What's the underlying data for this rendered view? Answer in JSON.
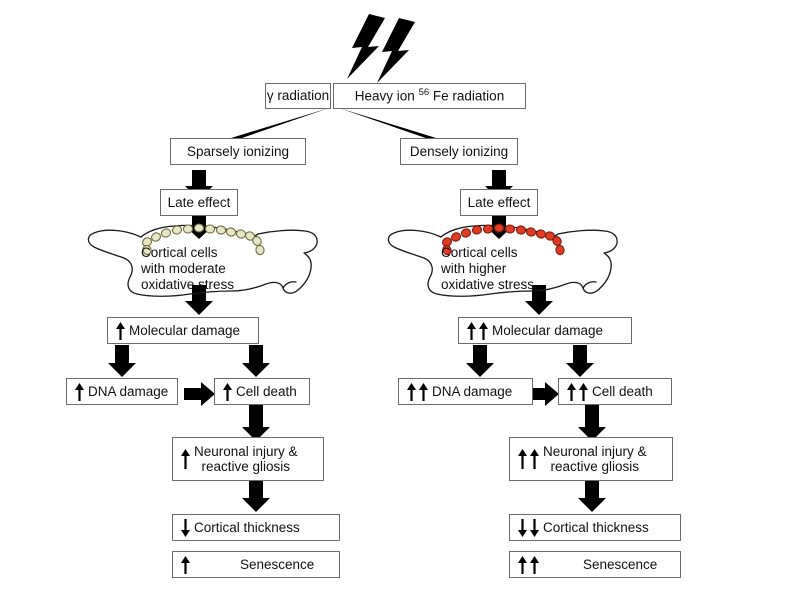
{
  "figure": {
    "title": "Radiation-induced cortical damage pathway schematic",
    "type": "flow-diagram",
    "background": "#ffffff",
    "colors": {
      "box_border": "#6b6b6b",
      "arrow_fill": "#000000",
      "bolt_fill": "#000000",
      "left_cell_fill": "#e8e6c8",
      "left_cell_stroke": "#6f6f3a",
      "right_cell_fill": "#e03c24",
      "right_cell_stroke": "#7d1b0c",
      "animal_outline": "#1a1a1a",
      "text": "#111111"
    }
  },
  "source": {
    "bolt_count": 2,
    "bolt_name": "radiation-bolts"
  },
  "top_boxes": [
    {
      "id": "gamma",
      "label": "γ radiation"
    },
    {
      "id": "heavy_ion",
      "label_pre": "Heavy ion ",
      "label_sup": "56",
      "label_post": " Fe radiation",
      "label_full": "Heavy ion 56 Fe radiation"
    }
  ],
  "branches": {
    "left": {
      "name": "sparsely-ionizing-branch",
      "ionizing": "Sparsely ionizing",
      "late_effect": "Late effect",
      "animal_caption": "Cortical cells\nwith moderate\noxidative stress",
      "cell_color": "#e8e6c8",
      "cell_count": 14,
      "steps": [
        {
          "id": "molecular_damage",
          "label": "Molecular damage",
          "arrows": "up",
          "arrow_count": 1
        },
        {
          "id": "dna_damage",
          "label": "DNA damage",
          "arrows": "up",
          "arrow_count": 1
        },
        {
          "id": "cell_death",
          "label": "Cell death",
          "arrows": "up",
          "arrow_count": 1
        },
        {
          "id": "neuronal_injury",
          "label": "Neuronal injury &\nreactive gliosis",
          "arrows": "up",
          "arrow_count": 1
        },
        {
          "id": "cortical_thickness",
          "label": "Cortical thickness",
          "arrows": "down",
          "arrow_count": 1
        },
        {
          "id": "senescence",
          "label": "Senescence",
          "arrows": "up",
          "arrow_count": 1
        }
      ]
    },
    "right": {
      "name": "densely-ionizing-branch",
      "ionizing": "Densely ionizing",
      "late_effect": "Late effect",
      "animal_caption": "Cortical cells\nwith higher\noxidative stress",
      "cell_color": "#e03c24",
      "cell_count": 14,
      "steps": [
        {
          "id": "molecular_damage",
          "label": "Molecular damage",
          "arrows": "up",
          "arrow_count": 2
        },
        {
          "id": "dna_damage",
          "label": "DNA damage",
          "arrows": "up",
          "arrow_count": 2
        },
        {
          "id": "cell_death",
          "label": "Cell death",
          "arrows": "up",
          "arrow_count": 2
        },
        {
          "id": "neuronal_injury",
          "label": "Neuronal injury &\nreactive gliosis",
          "arrows": "up",
          "arrow_count": 2
        },
        {
          "id": "cortical_thickness",
          "label": "Cortical thickness",
          "arrows": "down",
          "arrow_count": 2
        },
        {
          "id": "senescence",
          "label": "Senescence",
          "arrows": "up",
          "arrow_count": 2
        }
      ]
    }
  }
}
